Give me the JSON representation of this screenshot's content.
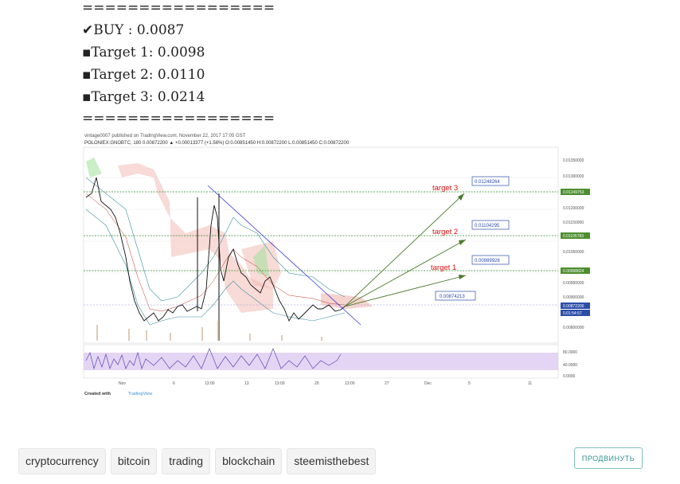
{
  "post": {
    "separator_top": "=================",
    "buy": "✔BUY : 0.0087",
    "target1": "▪Target 1: 0.0098",
    "target2": "▪Target 2: 0.0110",
    "target3": "▪Target 3: 0.0214",
    "separator_bottom": "================="
  },
  "chart": {
    "published_line": "vintage0007 published on TradingView.com, November 22, 2017 17:05 GST",
    "symbol_line": "POLONIEX:GNOBTC, 180  0.00872200 ▲ +0.00013377 (+1.56%)  O:0.00851450  H:0.00872200  L:0.00851450  C:0.00872200",
    "annotations": [
      {
        "text": "target 3",
        "value": "0.01248264"
      },
      {
        "text": "target 2",
        "value": "0.01104295"
      },
      {
        "text": "target 1",
        "value": "0.00989928"
      },
      {
        "text": "",
        "value": "0.00874213"
      }
    ],
    "price_axis": [
      "0.01350000",
      "0.01300000",
      "0.01249753",
      "0.01200000",
      "0.01150000",
      "0.01105783",
      "0.01050000",
      "0.00998824",
      "0.00950000",
      "0.00900000",
      "0.00872200",
      "0.01:54:57",
      "0.00800000"
    ],
    "osc_axis": [
      "80.0000",
      "40.0000",
      "0.0000"
    ],
    "time_axis": [
      "Nov",
      "6",
      "13:00",
      "13",
      "13:00",
      "20",
      "13:00",
      "27",
      "Dec",
      "5",
      "11"
    ],
    "footer": "Created with",
    "footer_brand": "TradingView"
  },
  "tags": [
    "cryptocurrency",
    "bitcoin",
    "trading",
    "blockchain",
    "steemisthebest"
  ],
  "promote_label": "ПРОДВИНУТЬ",
  "colors": {
    "target_line": "#2e8b2e",
    "trend_line": "#3b3bd6",
    "arrow": "#4a7a2a",
    "target_text": "#d11",
    "label_border": "#2b4ea8"
  }
}
